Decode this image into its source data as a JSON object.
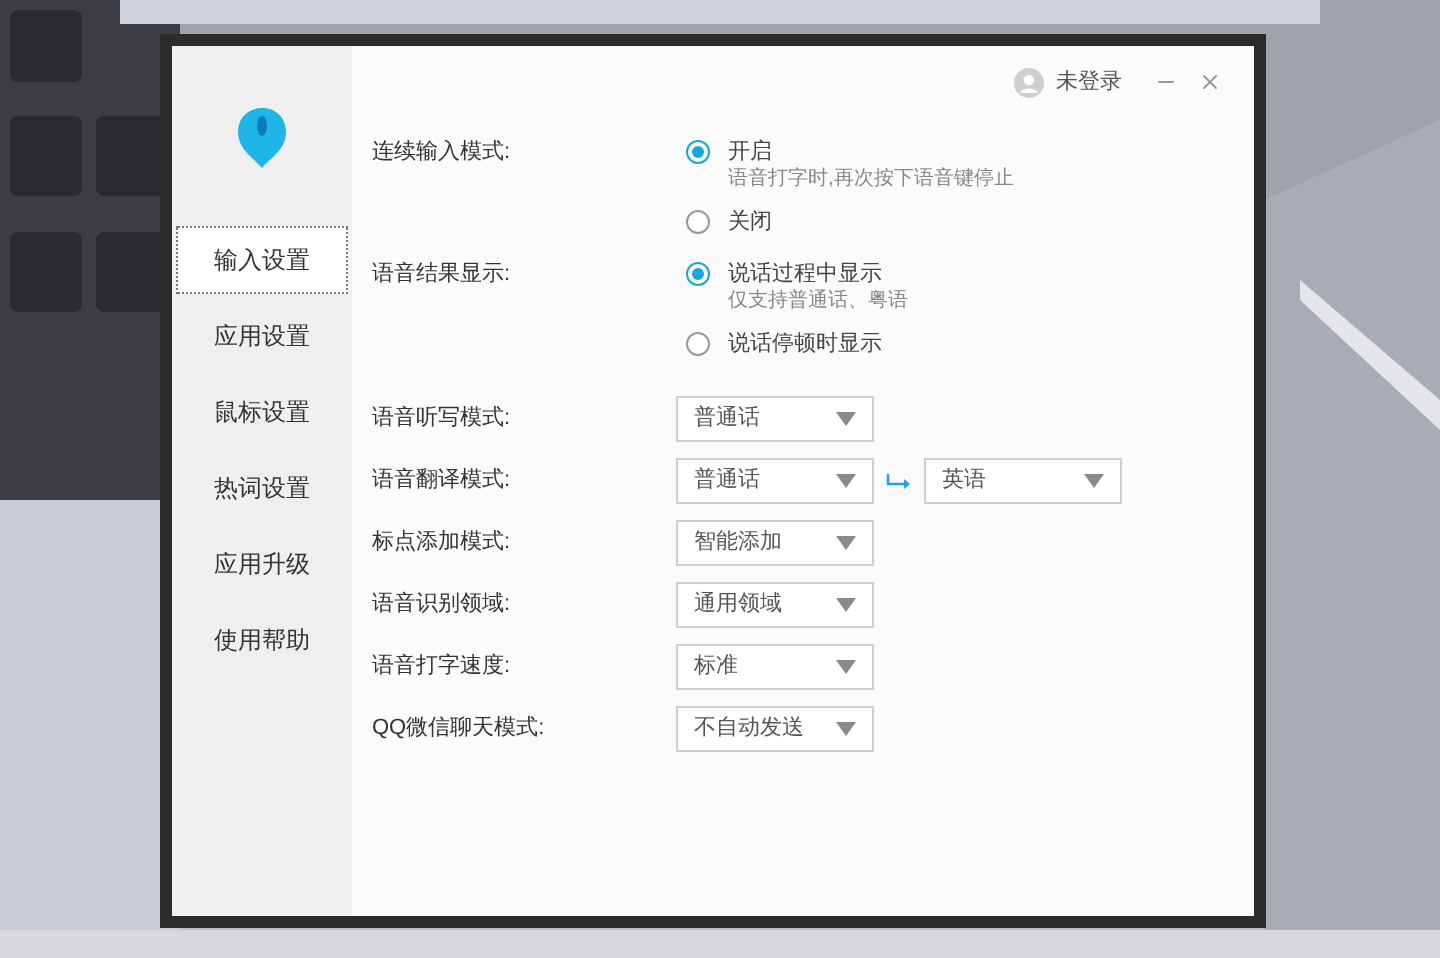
{
  "header": {
    "user": "未登录"
  },
  "sidebar": {
    "items": [
      {
        "label": "输入设置",
        "selected": true
      },
      {
        "label": "应用设置",
        "selected": false
      },
      {
        "label": "鼠标设置",
        "selected": false
      },
      {
        "label": "热词设置",
        "selected": false
      },
      {
        "label": "应用升级",
        "selected": false
      },
      {
        "label": "使用帮助",
        "selected": false
      }
    ]
  },
  "radio_groups": [
    {
      "label": "连续输入模式:",
      "options": [
        {
          "label": "开启",
          "hint": "语音打字时,再次按下语音键停止",
          "selected": true
        },
        {
          "label": "关闭",
          "selected": false
        }
      ]
    },
    {
      "label": "语音结果显示:",
      "options": [
        {
          "label": "说话过程中显示",
          "hint": "仅支持普通话、粤语",
          "selected": true
        },
        {
          "label": "说话停顿时显示",
          "selected": false
        }
      ]
    }
  ],
  "dropdowns": [
    {
      "label": "语音听写模式:",
      "value": "普通话"
    },
    {
      "label": "语音翻译模式:",
      "value": "普通话",
      "target": "英语"
    },
    {
      "label": "标点添加模式:",
      "value": "智能添加"
    },
    {
      "label": "语音识别领域:",
      "value": "通用领域"
    },
    {
      "label": "语音打字速度:",
      "value": "标准"
    },
    {
      "label": "QQ微信聊天模式:",
      "value": "不自动发送"
    }
  ]
}
